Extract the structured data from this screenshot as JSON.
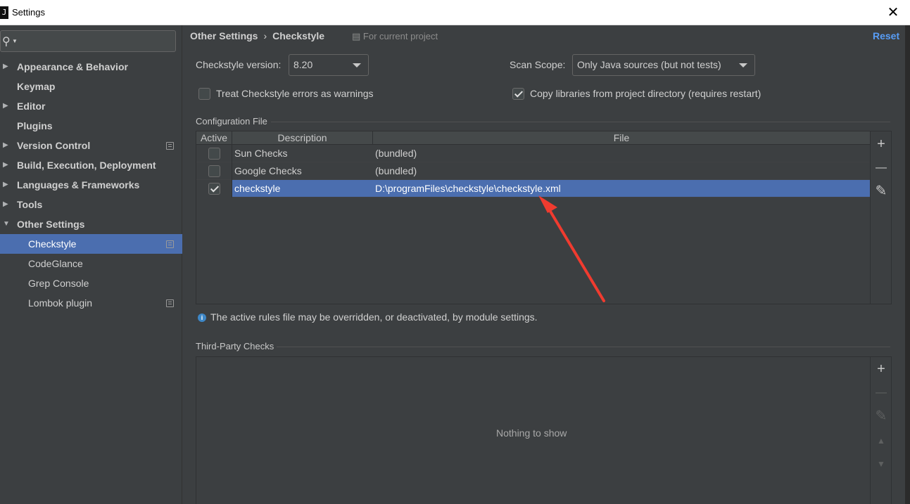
{
  "window": {
    "title": "Settings",
    "app_icon": "intellij-icon",
    "close_symbol": "✕"
  },
  "search": {
    "icon": "search-icon"
  },
  "sidebar": {
    "items": [
      {
        "label": "Appearance & Behavior",
        "expandable": true
      },
      {
        "label": "Keymap",
        "expandable": false
      },
      {
        "label": "Editor",
        "expandable": true
      },
      {
        "label": "Plugins",
        "expandable": false
      },
      {
        "label": "Version Control",
        "expandable": true,
        "project_icon": true
      },
      {
        "label": "Build, Execution, Deployment",
        "expandable": true
      },
      {
        "label": "Languages & Frameworks",
        "expandable": true
      },
      {
        "label": "Tools",
        "expandable": true
      },
      {
        "label": "Other Settings",
        "expandable": true,
        "expanded": true
      },
      {
        "label": "Checkstyle",
        "child": true,
        "selected": true,
        "project_icon": true
      },
      {
        "label": "CodeGlance",
        "child": true
      },
      {
        "label": "Grep Console",
        "child": true
      },
      {
        "label": "Lombok plugin",
        "child": true,
        "project_icon": true
      }
    ]
  },
  "header": {
    "breadcrumb_parent": "Other Settings",
    "breadcrumb_sep": "›",
    "breadcrumb_current": "Checkstyle",
    "for_project": "For current project",
    "reset": "Reset"
  },
  "options": {
    "version_label": "Checkstyle version:",
    "version_value": "8.20",
    "scope_label": "Scan Scope:",
    "scope_value": "Only Java sources (but not tests)",
    "treat_errors_label": "Treat Checkstyle errors as warnings",
    "treat_errors_checked": false,
    "copy_libs_label": "Copy libraries from project directory (requires restart)",
    "copy_libs_checked": true
  },
  "config": {
    "section_title": "Configuration File",
    "columns": [
      "Active",
      "Description",
      "File"
    ],
    "rows": [
      {
        "active": false,
        "description": "Sun Checks",
        "file": "(bundled)"
      },
      {
        "active": false,
        "description": "Google Checks",
        "file": "(bundled)"
      },
      {
        "active": true,
        "description": "checkstyle",
        "file": "D:\\programFiles\\checkstyle\\checkstyle.xml",
        "selected": true
      }
    ],
    "tools": [
      {
        "icon": "plus-icon",
        "symbol": "+"
      },
      {
        "icon": "minus-icon",
        "symbol": "—"
      },
      {
        "icon": "edit-icon",
        "symbol": "✎"
      }
    ]
  },
  "info_text": "The active rules file may be overridden, or deactivated, by module settings.",
  "third_party": {
    "section_title": "Third-Party Checks",
    "empty_text": "Nothing to show",
    "tools": [
      {
        "icon": "plus-icon",
        "symbol": "+",
        "enabled": true
      },
      {
        "icon": "minus-icon",
        "symbol": "—",
        "enabled": false
      },
      {
        "icon": "edit-icon",
        "symbol": "✎",
        "enabled": false
      },
      {
        "icon": "move-up-icon",
        "symbol": "▲",
        "enabled": false
      },
      {
        "icon": "move-down-icon",
        "symbol": "▼",
        "enabled": false
      }
    ]
  },
  "colors": {
    "accent": "#4b6eaf",
    "link": "#589df6",
    "annotation_arrow": "#f03b2f"
  }
}
